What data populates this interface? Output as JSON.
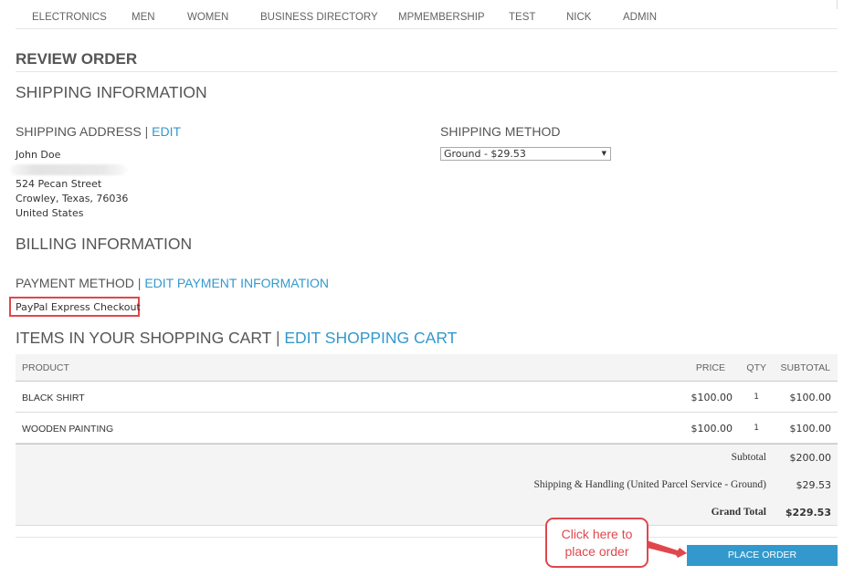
{
  "nav": {
    "items": [
      "ELECTRONICS",
      "MEN",
      "WOMEN",
      "BUSINESS DIRECTORY",
      "MPMEMBERSHIP",
      "TEST",
      "NICK",
      "ADMIN"
    ]
  },
  "page_title": "REVIEW ORDER",
  "shipping": {
    "section_title": "SHIPPING INFORMATION",
    "address_label": "SHIPPING ADDRESS",
    "separator": "|",
    "edit_link": "EDIT",
    "address": {
      "name": "John Doe",
      "street": "524 Pecan Street",
      "city_line": "Crowley, Texas, 76036",
      "country": "United States"
    },
    "method_label": "SHIPPING METHOD",
    "method_value": "Ground - $29.53"
  },
  "billing": {
    "section_title": "BILLING INFORMATION",
    "payment_label": "PAYMENT METHOD",
    "separator": "|",
    "edit_payment_link": "EDIT PAYMENT INFORMATION",
    "payment_value": "PayPal Express Checkout"
  },
  "cart": {
    "title": "ITEMS IN YOUR SHOPPING CART",
    "separator": "|",
    "edit_link": "EDIT SHOPPING CART",
    "headers": {
      "product": "PRODUCT",
      "price": "PRICE",
      "qty": "QTY",
      "subtotal": "SUBTOTAL"
    },
    "rows": [
      {
        "product": "BLACK SHIRT",
        "price": "$100.00",
        "qty": "1",
        "subtotal": "$100.00"
      },
      {
        "product": "WOODEN PAINTING",
        "price": "$100.00",
        "qty": "1",
        "subtotal": "$100.00"
      }
    ],
    "totals": {
      "subtotal_label": "Subtotal",
      "subtotal_value": "$200.00",
      "shipping_label": "Shipping & Handling (United Parcel Service - Ground)",
      "shipping_value": "$29.53",
      "grand_total_label": "Grand Total",
      "grand_total_value": "$229.53"
    }
  },
  "place_order_button": "PLACE ORDER",
  "callout": {
    "line1": "Click here to",
    "line2": "place order"
  },
  "colors": {
    "accent": "#3399cc",
    "callout": "#e0474c",
    "text": "#636363"
  }
}
